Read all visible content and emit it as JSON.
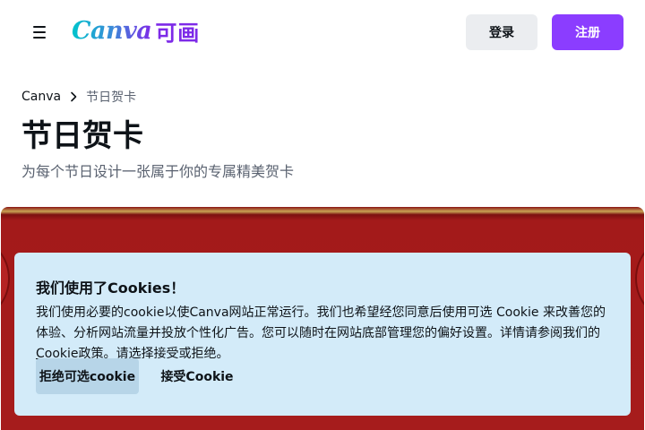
{
  "header": {
    "menu_icon": "hamburger-menu-icon",
    "logo_text": "Canva",
    "logo_cn": "可画",
    "login_label": "登录",
    "signup_label": "注册",
    "accent_color": "#8b3dff"
  },
  "breadcrumb": {
    "items": [
      "Canva",
      "节日贺卡"
    ],
    "separator_icon": "chevron-right-icon"
  },
  "page": {
    "title": "节日贺卡",
    "subtitle": "为每个节日设计一张属于你的专属精美贺卡"
  },
  "cookie_banner": {
    "title": "我们使用了Cookies！",
    "body_before_link": "我们使用必要的cookie以使Canva网站正常运行。我们也希望经您同意后使用可选 Cookie 来改善您的体验、分析网站流量并投放个性化广告。您可以随时在网站底部管理您的偏好设置。详情请参阅我们的",
    "link_text": "Cookie政策",
    "body_after_link": "。请选择接受或拒绝。",
    "reject_label": "拒绝可选cookie",
    "accept_label": "接受Cookie",
    "background_color": "#d3ebf9"
  }
}
